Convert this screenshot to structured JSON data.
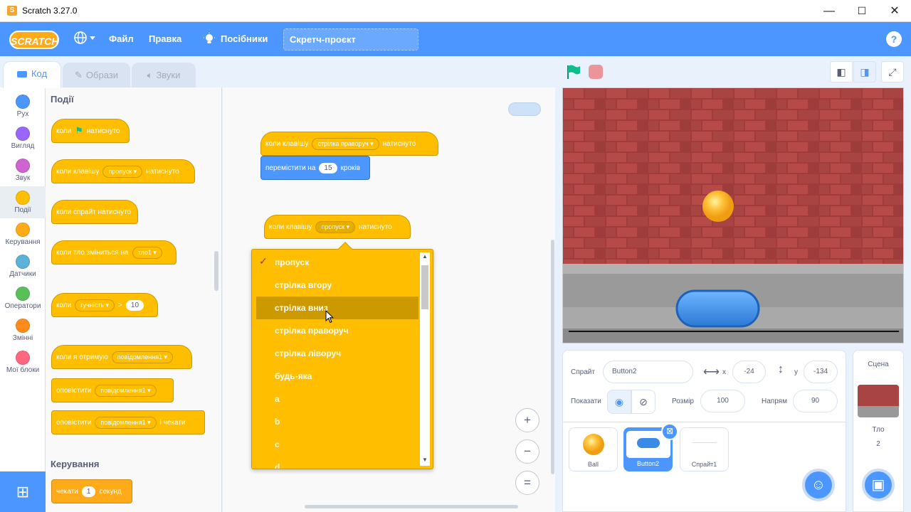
{
  "window": {
    "title": "Scratch 3.27.0",
    "min": "—",
    "max": "☐",
    "close": "✕"
  },
  "menubar": {
    "logo": "SCRATCH",
    "globe": "🌐",
    "file": "Файл",
    "edit": "Правка",
    "tutorials": "Посібники",
    "project_title": "Скретч-проєкт",
    "help": "?"
  },
  "tabs": {
    "code": "Код",
    "costumes": "Образи",
    "sounds": "Звуки"
  },
  "categories": [
    {
      "label": "Рух",
      "color": "#4c97ff"
    },
    {
      "label": "Вигляд",
      "color": "#9966ff"
    },
    {
      "label": "Звук",
      "color": "#cf63cf"
    },
    {
      "label": "Події",
      "color": "#ffbf00"
    },
    {
      "label": "Керування",
      "color": "#ffab19"
    },
    {
      "label": "Датчики",
      "color": "#5cb1d6"
    },
    {
      "label": "Оператори",
      "color": "#59c059"
    },
    {
      "label": "Змінні",
      "color": "#ff8c1a"
    },
    {
      "label": "Мої блоки",
      "color": "#ff6680"
    }
  ],
  "palette": {
    "events_title": "Події",
    "b1": {
      "pre": "коли",
      "post": "натиснуто"
    },
    "b2": {
      "pre": "коли клавішу",
      "dd": "пропуск",
      "post": "натиснуто"
    },
    "b3": {
      "text": "коли спрайт натиснуто"
    },
    "b4": {
      "pre": "коли тло зміниться на",
      "dd": "тло1"
    },
    "b5": {
      "pre": "коли",
      "dd": "гучність",
      "op": ">",
      "num": "10"
    },
    "b6": {
      "pre": "коли я отримую",
      "dd": "повідомлення1"
    },
    "b7": {
      "pre": "оповістити",
      "dd": "повідомлення1"
    },
    "b8": {
      "pre": "оповістити",
      "dd": "повідомлення1",
      "post": "і чекати"
    },
    "control_title": "Керування",
    "b9": {
      "pre": "чекати",
      "num": "1",
      "post": "секунд"
    }
  },
  "code": {
    "s1_hat": {
      "pre": "коли клавішу",
      "dd": "стрілка праворуч",
      "post": "натиснуто"
    },
    "s1_move": {
      "pre": "перемістити на",
      "num": "15",
      "post": "кроків"
    },
    "s2_hat": {
      "pre": "коли клавішу",
      "dd": "пропуск",
      "post": "натиснуто"
    },
    "zoom_in": "+",
    "zoom_out": "−",
    "zoom_reset": "="
  },
  "dropdown": {
    "checked_index": 0,
    "highlight_index": 2,
    "options": [
      "пропуск",
      "стрілка вгору",
      "стрілка вниз",
      "стрілка праворуч",
      "стрілка ліворуч",
      "будь-яка",
      "a",
      "b",
      "c",
      "d"
    ]
  },
  "sprite_info": {
    "sprite_label": "Спрайт",
    "sprite_name": "Button2",
    "x_label": "x",
    "x": "-24",
    "y_label": "y",
    "y": "-134",
    "show_label": "Показати",
    "size_label": "Розмір",
    "size": "100",
    "direction_label": "Напрям",
    "direction": "90"
  },
  "sprites": [
    {
      "name": "Ball",
      "selected": false
    },
    {
      "name": "Button2",
      "selected": true
    },
    {
      "name": "Спрайт1",
      "selected": false
    }
  ],
  "stage_panel": {
    "title": "Сцена",
    "backdrops_label": "Тло",
    "backdrops_count": "2"
  },
  "colors": {
    "accent": "#4c97ff",
    "events": "#ffbf00",
    "events_dark": "#cc9900",
    "motion": "#4c97ff"
  }
}
